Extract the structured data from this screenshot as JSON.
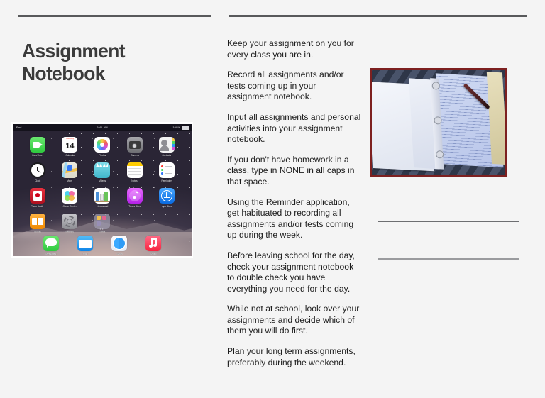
{
  "slide": {
    "title": "Assignment Notebook",
    "background_color": "#f4f4f4",
    "title_color": "#3b3b3b",
    "rule_color": "#58595b"
  },
  "body_text": {
    "paragraphs": [
      "Keep your assignment on you for every class you are in.",
      "Record all assignments and/or tests coming up in your assignment notebook.",
      "Input all assignments and personal activities into your assignment notebook.",
      "If you don't have homework in a class, type in NONE in all caps in that space.",
      "Using the Reminder application, get habituated to recording all assignments and/or tests coming up during the week.",
      "Before leaving school for the day, check your assignment notebook to double check you have everything you need for the day.",
      "While not at school, look over your assignments and decide which of them you will do first.",
      "Plan your long term assignments, preferably during the weekend."
    ]
  },
  "ipad_image": {
    "alt": "iPad home screen showing app icons",
    "status_bar": {
      "left": "iPad",
      "center": "9:41 AM",
      "right": "100%"
    },
    "page_dots": "••",
    "apps": [
      {
        "label": "FaceTime",
        "icon": "facetime-icon",
        "color": "#4cd964"
      },
      {
        "label": "Calendar",
        "icon": "calendar-icon",
        "color": "#ffffff",
        "day": "14",
        "weekday": "Tuesday"
      },
      {
        "label": "Photos",
        "icon": "photos-icon",
        "color": "#ffffff"
      },
      {
        "label": "Camera",
        "icon": "camera-icon",
        "color": "#8e8e93"
      },
      {
        "label": "Contacts",
        "icon": "contacts-icon",
        "color": "#f2f2f2"
      },
      {
        "label": "Clock",
        "icon": "clock-icon",
        "color": "#1c1c1e"
      },
      {
        "label": "Maps",
        "icon": "maps-icon",
        "color": "#e8e6df"
      },
      {
        "label": "Videos",
        "icon": "videos-icon",
        "color": "#5ac8d8"
      },
      {
        "label": "Notes",
        "icon": "notes-icon",
        "color": "#ffffff"
      },
      {
        "label": "Reminders",
        "icon": "reminders-icon",
        "color": "#ffffff"
      },
      {
        "label": "Photo Booth",
        "icon": "photo-booth-icon",
        "color": "#d0021b"
      },
      {
        "label": "Game Center",
        "icon": "game-center-icon",
        "color": "#ffffff"
      },
      {
        "label": "Newsstand",
        "icon": "newsstand-icon",
        "color": "#ffffff"
      },
      {
        "label": "iTunes Store",
        "icon": "itunes-store-icon",
        "color": "#d63aff"
      },
      {
        "label": "App Store",
        "icon": "app-store-icon",
        "color": "#0b84ff"
      },
      {
        "label": "iBooks",
        "icon": "ibooks-icon",
        "color": "#ff9500"
      },
      {
        "label": "Settings",
        "icon": "settings-icon",
        "color": "#9a9a9f"
      },
      {
        "label": "Extras",
        "icon": "extras-folder-icon",
        "color": "#8e8a9a"
      }
    ],
    "dock": [
      {
        "label": "Messages",
        "icon": "messages-icon",
        "color": "#4cd964"
      },
      {
        "label": "Mail",
        "icon": "mail-icon",
        "color": "#1d9bf0"
      },
      {
        "label": "Safari",
        "icon": "safari-icon",
        "color": "#ffffff"
      },
      {
        "label": "Music",
        "icon": "music-icon",
        "color": "#fc3158"
      }
    ]
  },
  "notebook_photo": {
    "alt": "Open three-ring binder with lined paper and a pen",
    "border_color": "#7d2020"
  }
}
